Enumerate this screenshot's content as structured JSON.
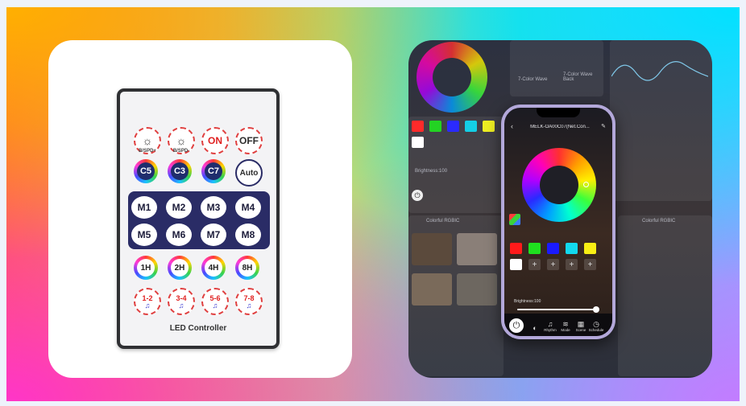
{
  "remote": {
    "top_row": [
      "",
      "",
      "ON",
      "OFF"
    ],
    "brightness_labels": [
      "B/SPD+",
      "B/SPD-"
    ],
    "color_row": [
      "C5",
      "C3",
      "C7",
      "Auto"
    ],
    "mode_buttons": [
      "M1",
      "M2",
      "M3",
      "M4",
      "M5",
      "M6",
      "M7",
      "M8"
    ],
    "timer_buttons": [
      "1H",
      "2H",
      "4H",
      "8H"
    ],
    "music_buttons": [
      "1-2",
      "3-4",
      "5-6",
      "7-8"
    ],
    "title": "LED Controller"
  },
  "app_background": {
    "tile_labels": [
      "7-Color Wave",
      "7-Color Wave Back"
    ],
    "brightness_label": "Brightness:100",
    "scene_header": "Colorful RGBIC"
  },
  "phone": {
    "title": "MELK-OA00C07(Net.Con...",
    "brightness_label": "Brightness:100",
    "tabs": [
      "",
      "",
      "Rhythm",
      "Mode",
      "Scene",
      "Schedule"
    ],
    "swatches": [
      "#ff1a1a",
      "#1fe01f",
      "#1a1aff",
      "#12d9ee",
      "#f8ee14",
      "#ffffff"
    ]
  }
}
